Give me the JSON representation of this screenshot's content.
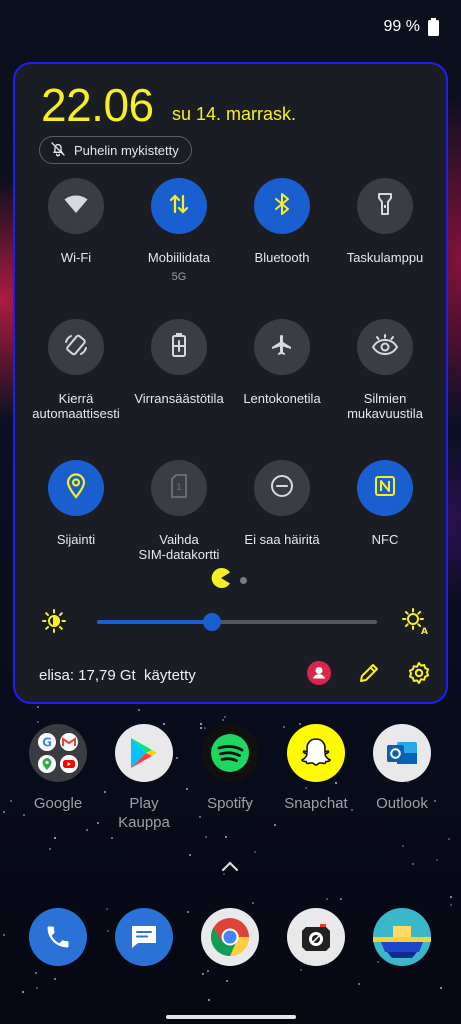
{
  "status_bar": {
    "battery_text": "99 %"
  },
  "quick_settings": {
    "time": "22.06",
    "date": "su 14. marrask.",
    "muted_chip": "Puhelin mykistetty",
    "tiles": [
      {
        "label": "Wi-Fi",
        "sublabel": "",
        "active": false,
        "icon": "wifi-icon"
      },
      {
        "label": "Mobiilidata",
        "sublabel": "5G",
        "active": true,
        "icon": "mobile-data-icon"
      },
      {
        "label": "Bluetooth",
        "sublabel": "",
        "active": true,
        "icon": "bluetooth-icon"
      },
      {
        "label": "Taskulamppu",
        "sublabel": "",
        "active": false,
        "icon": "flashlight-icon"
      },
      {
        "label": "Kierrä\nautomaattisesti",
        "sublabel": "",
        "active": false,
        "icon": "auto-rotate-icon"
      },
      {
        "label": "Virransäästötila",
        "sublabel": "",
        "active": false,
        "icon": "battery-saver-icon"
      },
      {
        "label": "Lentokonetila",
        "sublabel": "",
        "active": false,
        "icon": "airplane-icon"
      },
      {
        "label": "Silmien\nmukavuustila",
        "sublabel": "",
        "active": false,
        "icon": "eye-icon"
      },
      {
        "label": "Sijainti",
        "sublabel": "",
        "active": true,
        "icon": "location-icon"
      },
      {
        "label": "Vaihda\nSIM-datakortti",
        "sublabel": "",
        "active": false,
        "icon": "sim-card-icon"
      },
      {
        "label": "Ei saa häiritä",
        "sublabel": "",
        "active": false,
        "icon": "do-not-disturb-icon"
      },
      {
        "label": "NFC",
        "sublabel": "",
        "active": true,
        "icon": "nfc-icon"
      }
    ],
    "pages": 2,
    "current_page": 1,
    "brightness": 0.41,
    "data_usage": "elisa: 17,79 Gt  käytetty"
  },
  "home_apps": [
    {
      "label": "Google",
      "icon": "google-folder-icon"
    },
    {
      "label": "Play\nKauppa",
      "icon": "play-store-icon"
    },
    {
      "label": "Spotify",
      "icon": "spotify-icon"
    },
    {
      "label": "Snapchat",
      "icon": "snapchat-icon"
    },
    {
      "label": "Outlook",
      "icon": "outlook-icon"
    }
  ],
  "dock": [
    {
      "icon": "phone-icon"
    },
    {
      "icon": "messages-icon"
    },
    {
      "icon": "chrome-icon"
    },
    {
      "icon": "camera-icon"
    },
    {
      "icon": "gallery-icon"
    }
  ],
  "colors": {
    "accent_yellow": "#f5f022",
    "tile_active": "#1a5fd0",
    "tile_inactive": "#3b3d44",
    "panel_border": "#1f1ff5",
    "panel_bg": "#1b1d24"
  }
}
